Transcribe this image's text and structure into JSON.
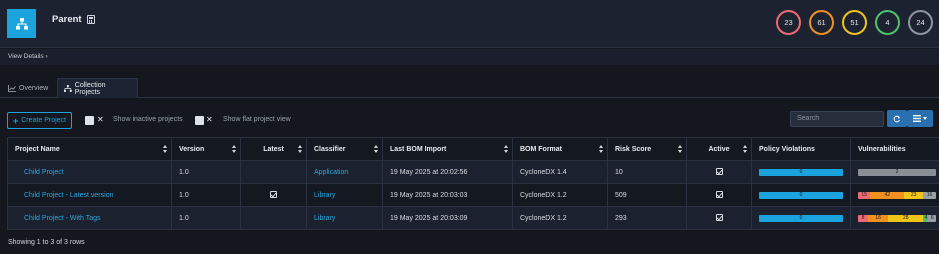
{
  "header": {
    "title": "Parent",
    "view_details": "View Details",
    "badges": [
      {
        "value": "23",
        "color": "#ee6a74"
      },
      {
        "value": "61",
        "color": "#f0901f"
      },
      {
        "value": "51",
        "color": "#f0c419"
      },
      {
        "value": "4",
        "color": "#4ec26b"
      },
      {
        "value": "24",
        "color": "#8d96a0"
      }
    ]
  },
  "tabs": [
    {
      "label": "Overview"
    },
    {
      "label": "Collection Projects"
    }
  ],
  "toolbar": {
    "create_label": "Create Project",
    "show_inactive": "Show inactive projects",
    "show_flat": "Show flat project view",
    "search_placeholder": "Search"
  },
  "table": {
    "columns": [
      "Project Name",
      "Version",
      "Latest",
      "Classifier",
      "Last BOM Import",
      "BOM Format",
      "Risk Score",
      "Active",
      "Policy Violations",
      "Vulnerabilities"
    ],
    "rows": [
      {
        "name": "Child Project",
        "version": "1.0",
        "latest": false,
        "classifier": "Application",
        "last_bom": "19 May 2025 at 20:02:56",
        "bom_format": "CycloneDX 1.4",
        "risk": "10",
        "active": true,
        "policy": "0",
        "vulns": [
          {
            "label": "2",
            "value": 2,
            "color": "#8a8f96"
          }
        ]
      },
      {
        "name": "Child Project - Latest version",
        "version": "1.0",
        "latest": true,
        "classifier": "Library",
        "last_bom": "19 May 2025 at 20:03:03",
        "bom_format": "CycloneDX 1.2",
        "risk": "509",
        "active": true,
        "policy": "0",
        "vulns": [
          {
            "label": "15",
            "value": 15,
            "color": "#ee6a74"
          },
          {
            "label": "42",
            "value": 42,
            "color": "#f0901f"
          },
          {
            "label": "23",
            "value": 23,
            "color": "#f0c419"
          },
          {
            "label": "16",
            "value": 16,
            "color": "#9aa0a7"
          }
        ]
      },
      {
        "name": "Child Project - With Tags",
        "version": "1.0",
        "latest": false,
        "classifier": "Library",
        "last_bom": "19 May 2025 at 20:03:09",
        "bom_format": "CycloneDX 1.2",
        "risk": "293",
        "active": true,
        "policy": "0",
        "vulns": [
          {
            "label": "8",
            "value": 8,
            "color": "#ee6a74"
          },
          {
            "label": "16",
            "value": 16,
            "color": "#f0901f"
          },
          {
            "label": "28",
            "value": 28,
            "color": "#f0c419"
          },
          {
            "label": "4",
            "value": 4,
            "color": "#4ec26b"
          },
          {
            "label": "6",
            "value": 6,
            "color": "#9aa0a7"
          }
        ]
      }
    ],
    "footer": "Showing 1 to 3 of 3 rows"
  },
  "colors": {
    "accent": "#1aa3dd",
    "policy_bar": "#1aa3dd"
  }
}
